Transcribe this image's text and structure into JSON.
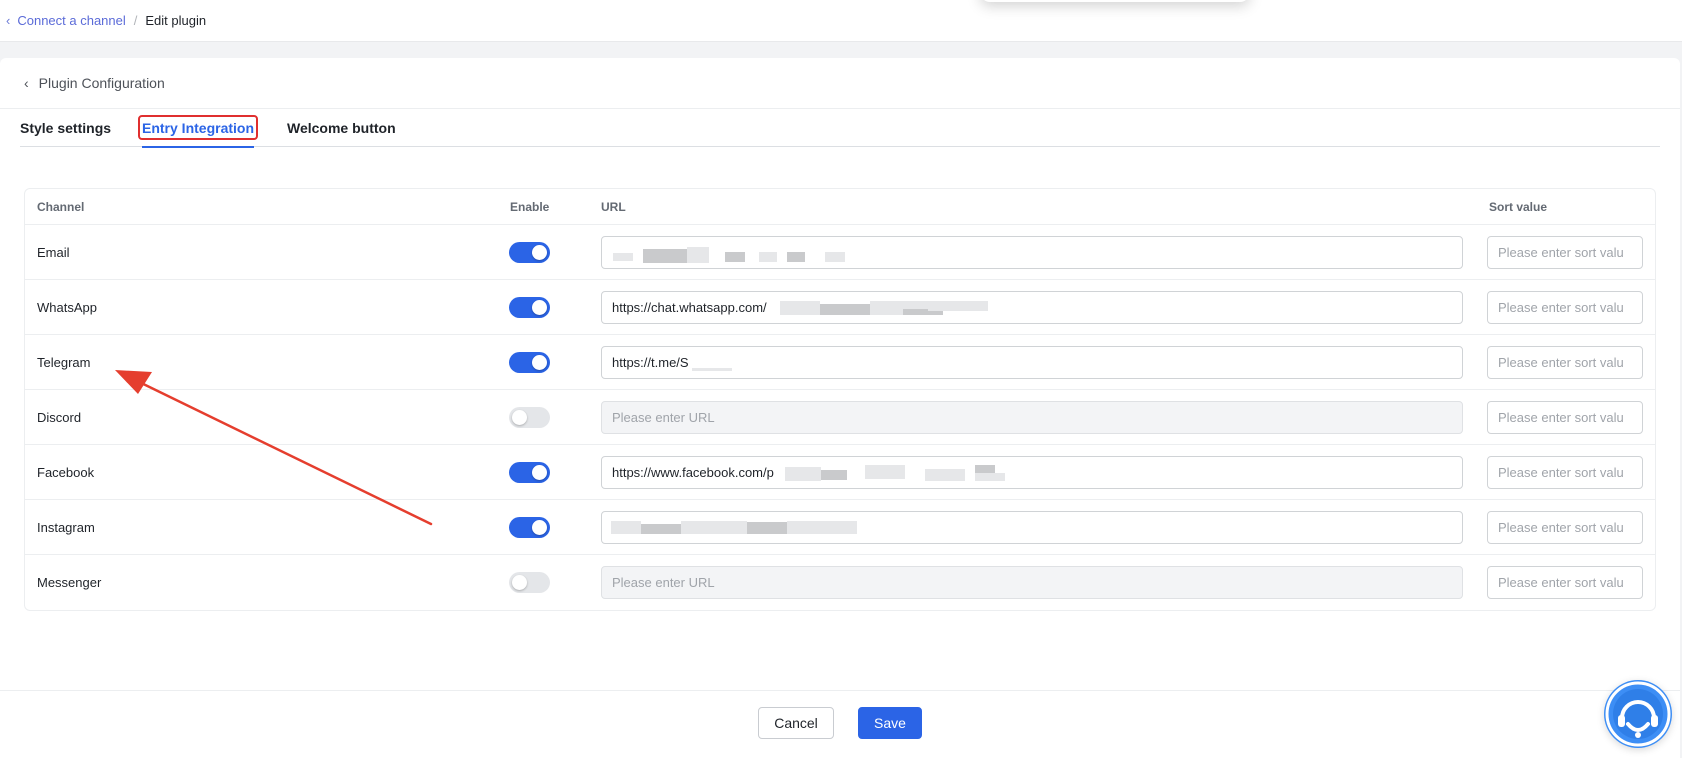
{
  "breadcrumb": {
    "parent": "Connect a channel",
    "current": "Edit plugin"
  },
  "header": {
    "title": "Plugin Configuration"
  },
  "tabs": [
    {
      "label": "Style settings",
      "active": false
    },
    {
      "label": "Entry Integration",
      "active": true
    },
    {
      "label": "Welcome button",
      "active": false
    }
  ],
  "table": {
    "columns": {
      "channel": "Channel",
      "enable": "Enable",
      "url": "URL",
      "sort": "Sort value"
    },
    "url_placeholder": "Please enter URL",
    "sort_placeholder": "Please enter sort valu",
    "rows": [
      {
        "channel": "Email",
        "enabled": true,
        "url": ""
      },
      {
        "channel": "WhatsApp",
        "enabled": true,
        "url": "https://chat.whatsapp.com/"
      },
      {
        "channel": "Telegram",
        "enabled": true,
        "url": "https://t.me/S"
      },
      {
        "channel": "Discord",
        "enabled": false,
        "url": ""
      },
      {
        "channel": "Facebook",
        "enabled": true,
        "url": "https://www.facebook.com/p"
      },
      {
        "channel": "Instagram",
        "enabled": true,
        "url": ""
      },
      {
        "channel": "Messenger",
        "enabled": false,
        "url": ""
      }
    ]
  },
  "footer": {
    "cancel_label": "Cancel",
    "save_label": "Save"
  },
  "colors": {
    "accent": "#2b64e6",
    "annotation": "#e53e2e",
    "support_bubble": "#3d8ef5"
  },
  "icons": {
    "breadcrumb_back": "chevron-left-icon",
    "header_back": "chevron-left-icon",
    "support": "headset-support-icon"
  }
}
